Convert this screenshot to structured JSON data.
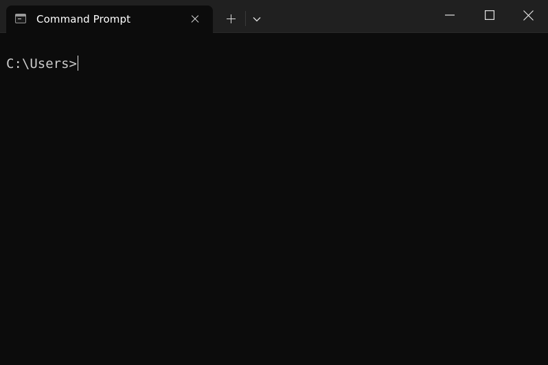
{
  "window": {
    "app": "Command Prompt"
  },
  "tabs": [
    {
      "title": "Command Prompt",
      "icon": "cmd-icon",
      "active": true
    }
  ],
  "toolbar": {
    "new_tab_icon": "plus-icon",
    "dropdown_icon": "chevron-down-icon"
  },
  "window_controls": {
    "minimize_icon": "minimize-icon",
    "maximize_icon": "maximize-icon",
    "close_icon": "close-icon"
  },
  "terminal": {
    "prompt": "C:\\Users>",
    "input": ""
  },
  "colors": {
    "titlebar": "#202020",
    "background": "#0c0c0c",
    "text": "#cccccc"
  }
}
